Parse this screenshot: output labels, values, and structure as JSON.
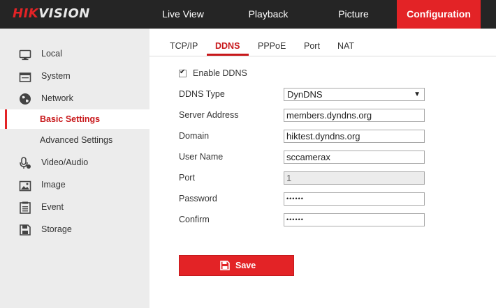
{
  "brand": {
    "name": "HIKVISION"
  },
  "nav": {
    "live_view": "Live View",
    "playback": "Playback",
    "picture": "Picture",
    "configuration": "Configuration"
  },
  "sidebar": {
    "items": [
      {
        "label": "Local",
        "icon": "monitor-icon"
      },
      {
        "label": "System",
        "icon": "system-icon"
      },
      {
        "label": "Network",
        "icon": "globe-icon"
      },
      {
        "label": "Basic Settings",
        "active": true
      },
      {
        "label": "Advanced Settings"
      },
      {
        "label": "Video/Audio",
        "icon": "microphone-icon"
      },
      {
        "label": "Image",
        "icon": "image-icon"
      },
      {
        "label": "Event",
        "icon": "event-list-icon"
      },
      {
        "label": "Storage",
        "icon": "floppy-disk-icon"
      }
    ]
  },
  "tabs": [
    "TCP/IP",
    "DDNS",
    "PPPoE",
    "Port",
    "NAT"
  ],
  "active_tab": "DDNS",
  "form": {
    "enable_ddns": {
      "label": "Enable DDNS",
      "checked": true
    },
    "ddns_type": {
      "label": "DDNS Type",
      "value": "DynDNS"
    },
    "server_address": {
      "label": "Server Address",
      "value": "members.dyndns.org"
    },
    "domain": {
      "label": "Domain",
      "value": "hiktest.dyndns.org"
    },
    "user_name": {
      "label": "User Name",
      "value": "sccamerax"
    },
    "port": {
      "label": "Port",
      "value": "1"
    },
    "password": {
      "label": "Password",
      "value": "••••••"
    },
    "confirm": {
      "label": "Confirm",
      "value": "••••••"
    }
  },
  "save_button": {
    "label": "Save"
  },
  "colors": {
    "accent": "#e32326",
    "header_bg": "#252525",
    "sidebar_bg": "#ececec"
  }
}
